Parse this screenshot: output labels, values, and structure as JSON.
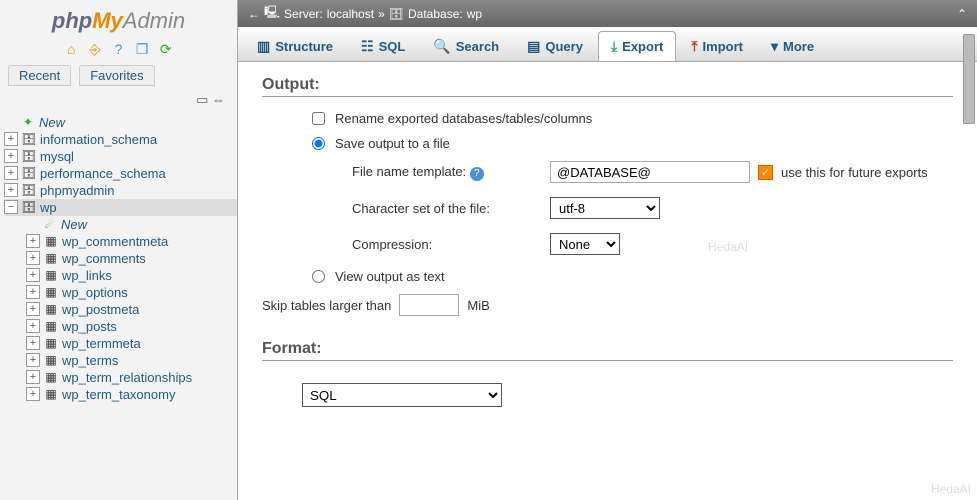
{
  "logo": {
    "php": "php",
    "my": "My",
    "admin": "Admin"
  },
  "recent_favorites": {
    "recent": "Recent",
    "favorites": "Favorites"
  },
  "tree": {
    "new": "New",
    "dbs": [
      "information_schema",
      "mysql",
      "performance_schema",
      "phpmyadmin"
    ],
    "selected_db": "wp",
    "selected_children": {
      "new": "New",
      "tables": [
        "wp_commentmeta",
        "wp_comments",
        "wp_links",
        "wp_options",
        "wp_postmeta",
        "wp_posts",
        "wp_termmeta",
        "wp_terms",
        "wp_term_relationships",
        "wp_term_taxonomy"
      ]
    }
  },
  "breadcrumb": {
    "server_label": "Server:",
    "server": "localhost",
    "db_label": "Database:",
    "db": "wp"
  },
  "tabs": {
    "structure": "Structure",
    "sql": "SQL",
    "search": "Search",
    "query": "Query",
    "export": "Export",
    "import": "Import",
    "more": "More"
  },
  "output": {
    "heading": "Output:",
    "rename": "Rename exported databases/tables/columns",
    "save": "Save output to a file",
    "fname_label": "File name template:",
    "fname_value": "@DATABASE@",
    "use_future": "use this for future exports",
    "charset_label": "Character set of the file:",
    "charset_value": "utf-8",
    "compression_label": "Compression:",
    "compression_value": "None",
    "view_text": "View output as text",
    "skip_label": "Skip tables larger than",
    "skip_unit": "MiB"
  },
  "format": {
    "heading": "Format:",
    "value": "SQL"
  }
}
